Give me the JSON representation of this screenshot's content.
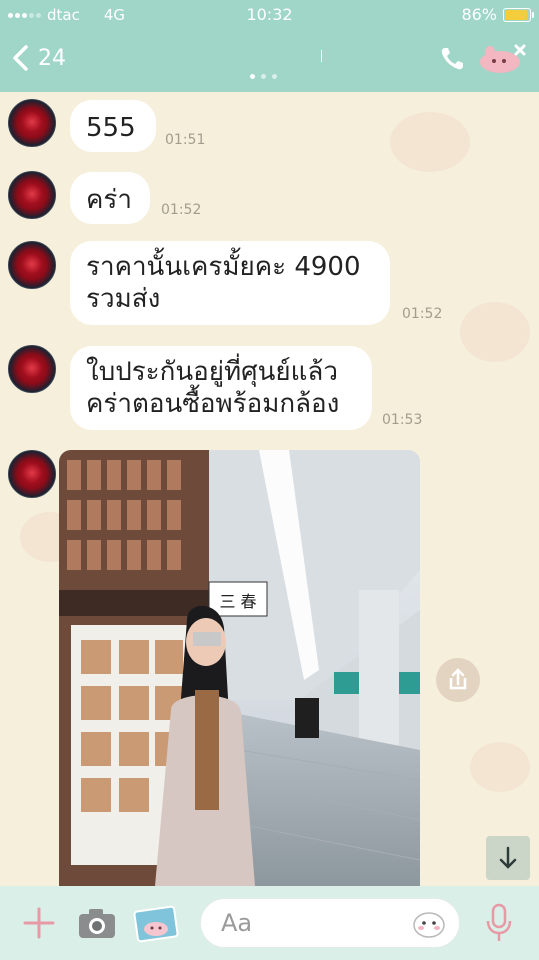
{
  "status_bar": {
    "carrier": "dtac",
    "network": "4G",
    "time": "10:32",
    "battery": "86%",
    "battery_level": 0.86
  },
  "nav": {
    "back_count": "24",
    "back_icon": "chevron-left-icon",
    "call_icon": "phone-icon",
    "sticker_icon": "sticker-icon"
  },
  "messages": [
    {
      "text": "555",
      "time": "01:51"
    },
    {
      "text": "คร่า",
      "time": "01:52"
    },
    {
      "line1": "ราคานั้นเครมั้ยคะ 4900",
      "line2": "รวมส่ง",
      "time": "01:52"
    },
    {
      "line1": "ใบประกันอยู่ที่ศุนย์แล้ว",
      "line2": "คร่าตอนซื้อพร้อมกล้อง",
      "time": "01:53"
    }
  ],
  "photo": {
    "sign_text": "三 春"
  },
  "input_bar": {
    "placeholder": "Aa",
    "plus_icon": "plus-icon",
    "camera_icon": "camera-icon",
    "image_icon": "image-icon",
    "emoji_icon": "emoji-icon",
    "mic_icon": "microphone-icon"
  },
  "colors": {
    "header": "#9fd6c8",
    "chat_bg": "#f6efdc",
    "input_bar": "#d9efe8",
    "accent_pink": "#e79aa6"
  }
}
